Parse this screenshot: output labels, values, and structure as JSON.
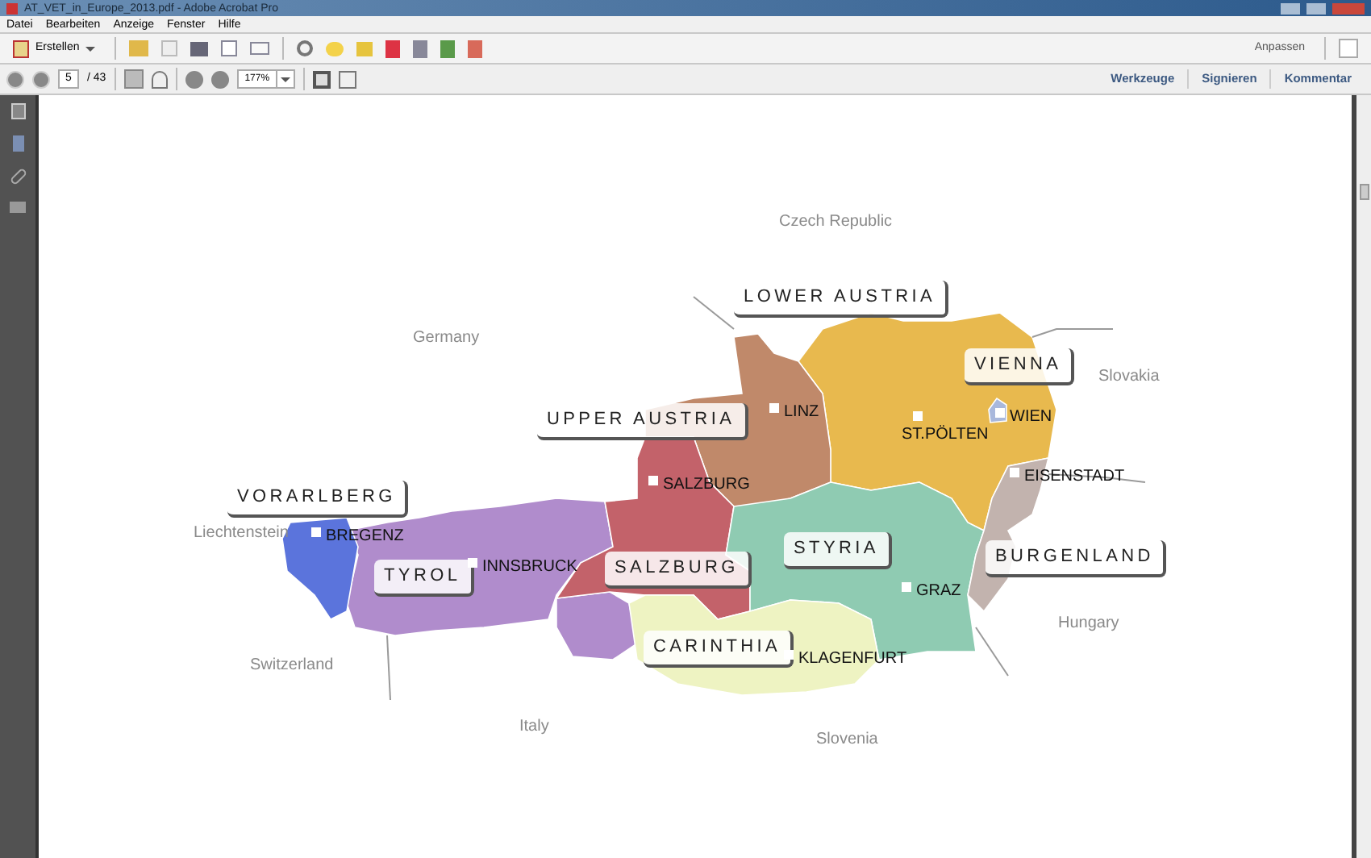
{
  "window": {
    "title": "AT_VET_in_Europe_2013.pdf - Adobe Acrobat Pro"
  },
  "menu": [
    "Datei",
    "Bearbeiten",
    "Anzeige",
    "Fenster",
    "Hilfe"
  ],
  "toolbar": {
    "create": "Erstellen",
    "customize": "Anpassen"
  },
  "navigation": {
    "page": "5",
    "page_count": "/ 43",
    "zoom": "177%"
  },
  "panel_tabs": [
    {
      "label": "Werkzeuge"
    },
    {
      "label": "Signieren"
    },
    {
      "label": "Kommentar"
    }
  ],
  "map": {
    "countries": [
      "Czech Republic",
      "Germany",
      "Slovakia",
      "Liechtenstein",
      "Switzerland",
      "Italy",
      "Slovenia",
      "Hungary"
    ],
    "regions": [
      {
        "name": "LOWER AUSTRIA",
        "color": "#e8b94e"
      },
      {
        "name": "VIENNA",
        "color": "#a9b8dc"
      },
      {
        "name": "UPPER AUSTRIA",
        "color": "#c0896a"
      },
      {
        "name": "VORARLBERG",
        "color": "#5b74dc"
      },
      {
        "name": "TYROL",
        "color": "#b08ccc"
      },
      {
        "name": "SALZBURG",
        "color": "#c3626a"
      },
      {
        "name": "STYRIA",
        "color": "#8fcbb2"
      },
      {
        "name": "BURGENLAND",
        "color": "#c2b3ae"
      },
      {
        "name": "CARINTHIA",
        "color": "#eef3c2"
      }
    ],
    "cities": [
      "LINZ",
      "ST.PÖLTEN",
      "WIEN",
      "EISENSTADT",
      "SALZBURG",
      "BREGENZ",
      "INNSBRUCK",
      "GRAZ",
      "KLAGENFURT"
    ]
  }
}
